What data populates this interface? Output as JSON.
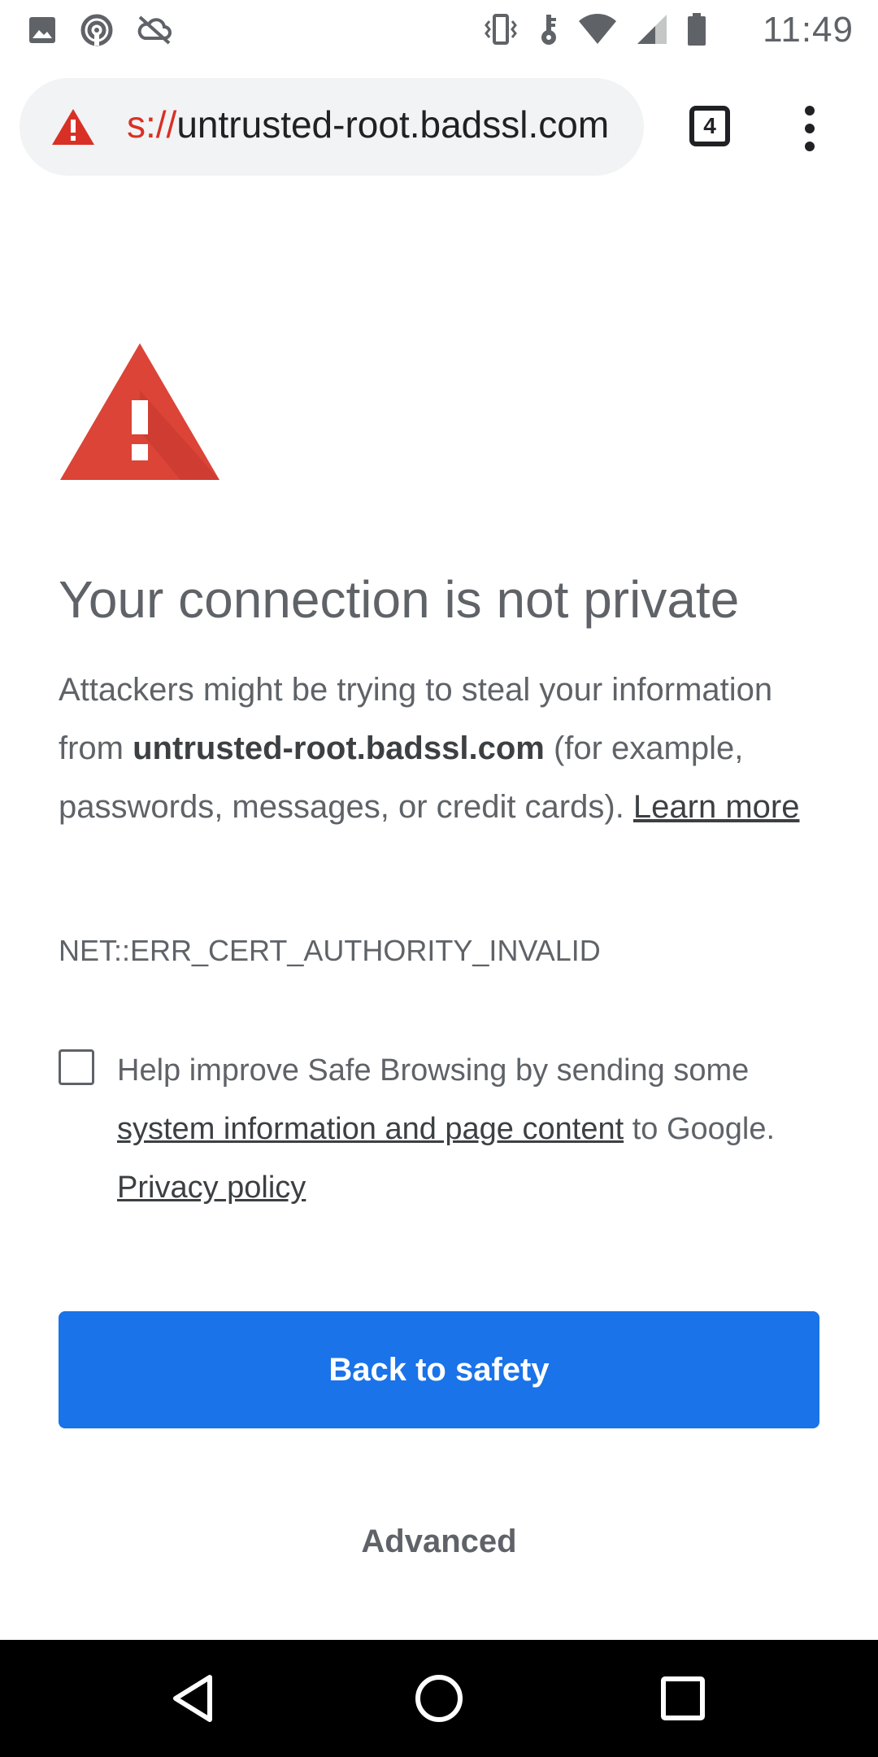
{
  "status_bar": {
    "time": "11:49",
    "left_icons": [
      "image-icon",
      "hotspot-icon",
      "sync-off-icon"
    ],
    "right_icons": [
      "vibrate-icon",
      "key-icon",
      "wifi-icon",
      "cellular-icon",
      "battery-icon"
    ]
  },
  "toolbar": {
    "url_scheme": "s://",
    "url_host": "untrusted-root.badssl.com",
    "tab_count": "4"
  },
  "interstitial": {
    "heading": "Your connection is not private",
    "explanation_part1": "Attackers might be trying to steal your information from ",
    "explanation_host": "untrusted-root.badssl.com",
    "explanation_part2": " (for example, passwords, messages, or credit cards). ",
    "learn_more": "Learn more",
    "error_code": "NET::ERR_CERT_AUTHORITY_INVALID",
    "optin_part1": "Help improve Safe Browsing by sending some ",
    "optin_link": "system information and page content",
    "optin_part2": " to Google. ",
    "privacy_link": "Privacy policy",
    "optin_checked": false,
    "primary_button": "Back to safety",
    "advanced_button": "Advanced"
  },
  "colors": {
    "warning_red": "#d93025",
    "primary_blue": "#1a73e8",
    "text_gray": "#5f6368"
  }
}
